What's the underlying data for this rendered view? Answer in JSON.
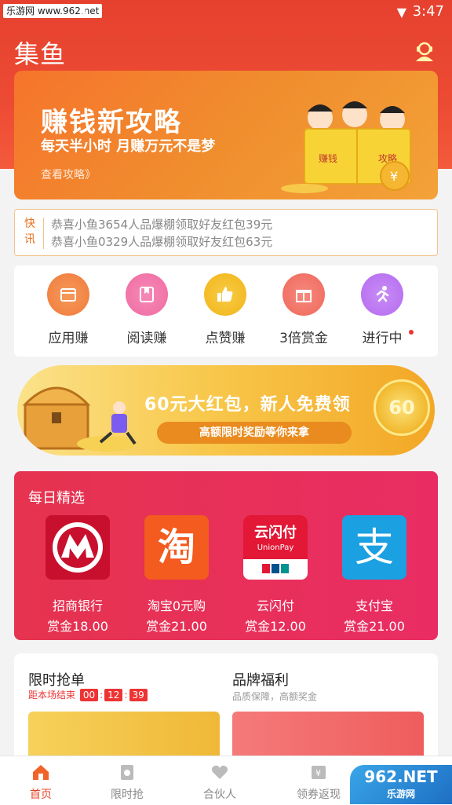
{
  "status": {
    "watermark": "乐游网 www.962.net",
    "time": "3:47"
  },
  "app": {
    "title": "集鱼"
  },
  "banner": {
    "title": "赚钱新攻略",
    "subtitle": "每天半小时 月赚万元不是梦",
    "more": "查看攻略》",
    "book_left": "赚钱",
    "book_right": "攻略"
  },
  "ticker": {
    "tag": "快讯",
    "lines": [
      "恭喜小鱼3654人品爆棚领取好友红包39元",
      "恭喜小鱼0329人品爆棚领取好友红包63元"
    ]
  },
  "categories": [
    {
      "label": "应用赚",
      "icon": "box-icon",
      "color": "#f07a3a"
    },
    {
      "label": "阅读赚",
      "icon": "book-icon",
      "color": "#f06aa0"
    },
    {
      "label": "点赞赚",
      "icon": "thumbs-up-icon",
      "color": "#f2b418"
    },
    {
      "label": "3倍赏金",
      "icon": "gift-icon",
      "color": "#f0675a"
    },
    {
      "label": "进行中",
      "icon": "running-icon",
      "color": "#b46bf0"
    }
  ],
  "promo": {
    "title": "60元大红包，新人免费领",
    "pill": "高额限时奖励等你来拿",
    "coin": "60"
  },
  "daily": {
    "title": "每日精选",
    "picks": [
      {
        "name": "招商银行",
        "reward": "赏金18.00"
      },
      {
        "name": "淘宝0元购",
        "reward": "赏金21.00"
      },
      {
        "name": "云闪付",
        "reward": "赏金12.00"
      },
      {
        "name": "支付宝",
        "reward": "赏金21.00"
      }
    ],
    "logos": {
      "taobao": "淘",
      "unionpay_cn": "云闪付",
      "unionpay_en": "UnionPay",
      "alipay": "支"
    }
  },
  "flash": {
    "title": "限时抢单",
    "countdown_label": "距本场结束",
    "h": "00",
    "m": "12",
    "s": "39"
  },
  "brand": {
    "title": "品牌福利",
    "subtitle": "品质保障，高额奖金"
  },
  "tabs": [
    {
      "label": "首页",
      "active": true
    },
    {
      "label": "限时抢",
      "active": false
    },
    {
      "label": "合伙人",
      "active": false
    },
    {
      "label": "领券返现",
      "active": false
    }
  ],
  "corner_watermark": {
    "big": "962.NET",
    "small": "乐游网"
  },
  "colors": {
    "brand_red": "#e6412f",
    "banner_orange": "#f6742c",
    "daily_red": "#e6334f"
  }
}
